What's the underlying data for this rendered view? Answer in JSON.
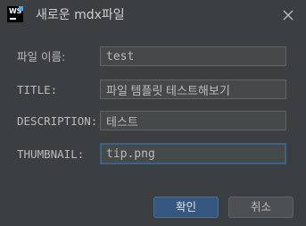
{
  "window": {
    "title": "새로운 mdx파일",
    "app_icon_label": "WS",
    "close_icon": "close-icon"
  },
  "form": {
    "fields": [
      {
        "label": "파일 이름:",
        "value": "test"
      },
      {
        "label": "TITLE:",
        "value": "파일 템플릿 테스트해보기"
      },
      {
        "label": "DESCRIPTION:",
        "value": "테스트"
      },
      {
        "label": "THUMBNAIL:",
        "value": "tip.png"
      }
    ]
  },
  "buttons": {
    "ok_label": "확인",
    "cancel_label": "취소"
  },
  "colors": {
    "background": "#3c3f41",
    "field_background": "#45494a",
    "focus_border": "#3d6185",
    "primary_button": "#365880"
  }
}
